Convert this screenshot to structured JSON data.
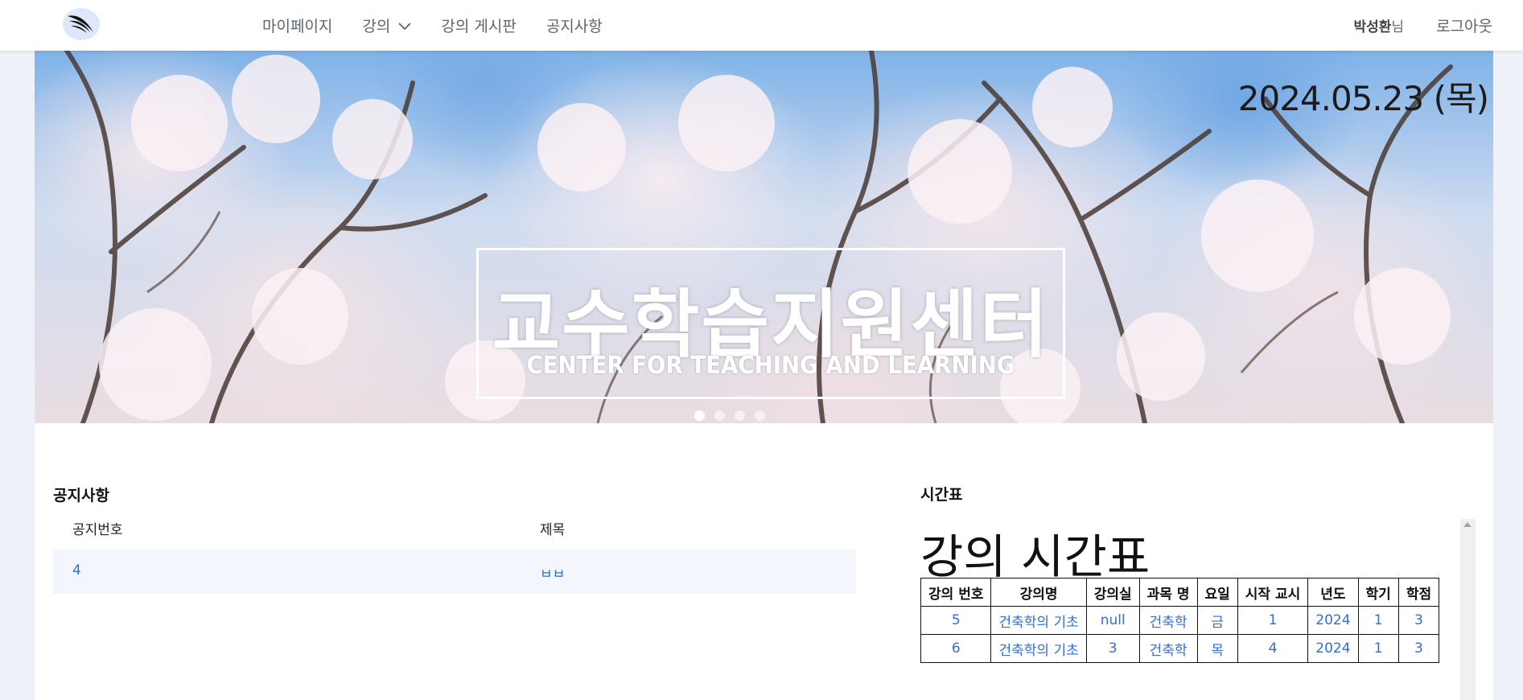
{
  "header": {
    "logo_icon": "swoosh-logo-icon",
    "nav": [
      {
        "label": "마이페이지"
      },
      {
        "label": "강의",
        "icon": "chevron-down-icon"
      },
      {
        "label": "강의 게시판"
      },
      {
        "label": "공지사항"
      }
    ],
    "user_name": "박성환",
    "user_suffix": "님",
    "logout_label": "로그아웃"
  },
  "banner": {
    "date": "2024.05.23 (목)",
    "title_ko": "교수학습지원센터",
    "title_en": "CENTER FOR TEACHING AND LEARNING",
    "slide_count": 4,
    "active_slide": 1
  },
  "notice": {
    "title": "공지사항",
    "columns": [
      "공지번호",
      "제목"
    ],
    "rows": [
      {
        "no": "4",
        "subject": "ㅂㅂ"
      }
    ]
  },
  "timetable": {
    "section_title": "시간표",
    "heading": "강의 시간표",
    "columns": [
      "강의 번호",
      "강의명",
      "강의실",
      "과목 명",
      "요일",
      "시작 교시",
      "년도",
      "학기",
      "학점"
    ],
    "rows": [
      [
        "5",
        "건축학의 기초",
        "null",
        "건축학",
        "금",
        "1",
        "2024",
        "1",
        "3"
      ],
      [
        "6",
        "건축학의 기초",
        "3",
        "건축학",
        "목",
        "4",
        "2024",
        "1",
        "3"
      ]
    ]
  },
  "colors": {
    "link": "#2f6fd6",
    "nav_text": "#5d6470",
    "page_bg": "#eef2f8",
    "row_highlight": "#f3f6fc"
  }
}
